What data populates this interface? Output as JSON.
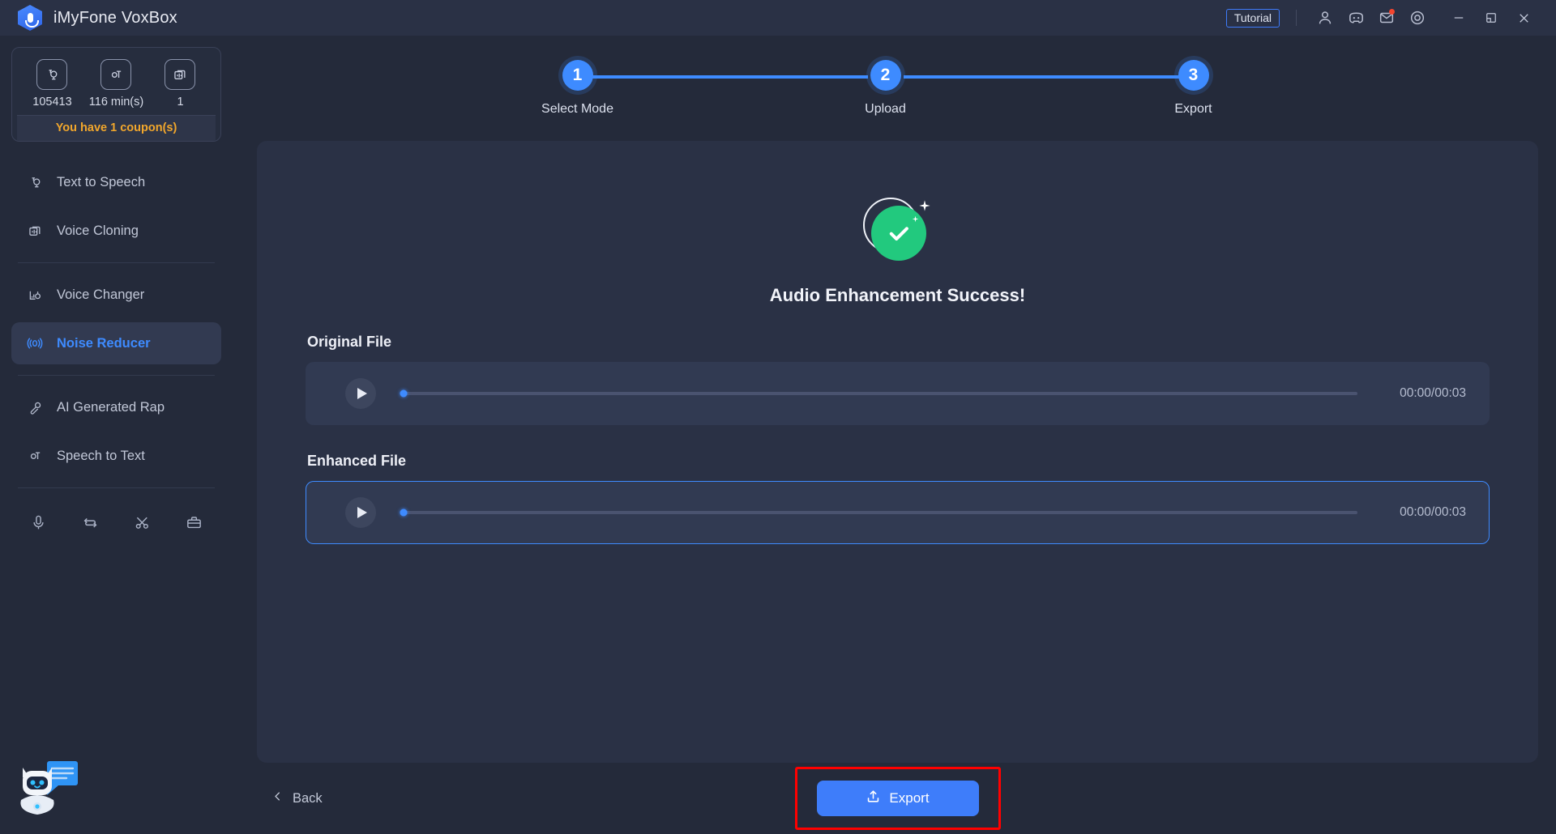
{
  "window": {
    "app_title": "iMyFone VoxBox",
    "logo_icon": "voxbox-mic-logo",
    "tutorial_label": "Tutorial",
    "icons": {
      "account": "user-icon",
      "community": "discord-icon",
      "messages": "mail-icon",
      "settings": "settings-icon",
      "minimize": "minimize-icon",
      "maximize": "maximize-icon",
      "close": "close-icon"
    }
  },
  "sidebar": {
    "credits": [
      {
        "icon": "text-to-speech-icon",
        "value": "105413"
      },
      {
        "icon": "speech-to-text-icon",
        "value": "116 min(s)"
      },
      {
        "icon": "voice-cloning-icon",
        "value": "1"
      }
    ],
    "coupon_text": "You have 1 coupon(s)",
    "items": [
      {
        "label": "Text to Speech",
        "icon": "text-to-speech-icon",
        "active": false
      },
      {
        "label": "Voice Cloning",
        "icon": "voice-cloning-icon",
        "active": false
      },
      {
        "label": "Voice Changer",
        "icon": "voice-changer-icon",
        "active": false
      },
      {
        "label": "Noise Reducer",
        "icon": "noise-reducer-icon",
        "active": true
      },
      {
        "label": "AI Generated Rap",
        "icon": "ai-rap-icon",
        "active": false
      },
      {
        "label": "Speech to Text",
        "icon": "speech-to-text-icon",
        "active": false
      }
    ],
    "tools": [
      {
        "icon": "record-icon"
      },
      {
        "icon": "convert-icon"
      },
      {
        "icon": "cut-icon"
      },
      {
        "icon": "toolbox-icon"
      }
    ],
    "assistant_icon": "chat-bot-icon"
  },
  "stepper": {
    "steps": [
      {
        "number": "1",
        "label": "Select Mode"
      },
      {
        "number": "2",
        "label": "Upload"
      },
      {
        "number": "3",
        "label": "Export"
      }
    ],
    "accent_color": "#3E8BFF"
  },
  "main": {
    "status_icon": "success-check-icon",
    "status_color": "#22C97E",
    "success_title": "Audio Enhancement Success!",
    "players": [
      {
        "label": "Original File",
        "play_icon": "play-icon",
        "time": "00:00/00:03",
        "progress": 0,
        "highlighted": false
      },
      {
        "label": "Enhanced File",
        "play_icon": "play-icon",
        "time": "00:00/00:03",
        "progress": 0,
        "highlighted": true
      }
    ]
  },
  "footer": {
    "back_label": "Back",
    "back_icon": "chevron-left-icon",
    "export_label": "Export",
    "export_icon": "upload-icon",
    "highlight_color": "#FF0000"
  }
}
